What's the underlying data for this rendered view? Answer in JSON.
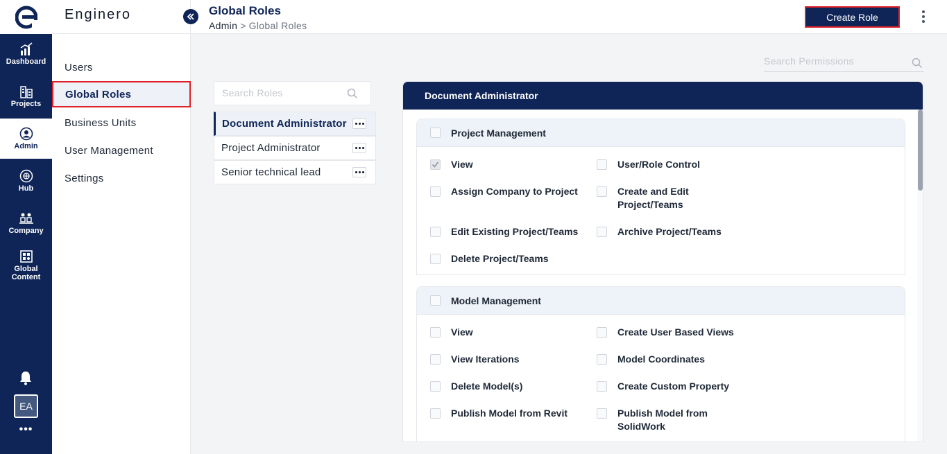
{
  "app": {
    "name": "Enginero",
    "logo_letter": "e"
  },
  "rail": {
    "items": [
      {
        "label": "Dashboard",
        "icon": "chart-up-icon"
      },
      {
        "label": "Projects",
        "icon": "buildings-icon"
      },
      {
        "label": "Admin",
        "icon": "admin-user-icon",
        "active": true
      },
      {
        "label": "Hub",
        "icon": "hub-network-icon"
      },
      {
        "label": "Company",
        "icon": "company-people-icon"
      },
      {
        "label": "Global",
        "label2": "Content",
        "icon": "global-content-icon"
      }
    ],
    "avatar_initials": "EA",
    "more": "•••"
  },
  "subnav": {
    "items": [
      {
        "label": "Users"
      },
      {
        "label": "Global Roles",
        "active": true
      },
      {
        "label": "Business Units"
      },
      {
        "label": "User Management"
      },
      {
        "label": "Settings"
      }
    ]
  },
  "header": {
    "title": "Global Roles",
    "breadcrumb_root": "Admin",
    "breadcrumb_sep": ">",
    "breadcrumb_current": "Global Roles",
    "create_role_label": "Create Role"
  },
  "search": {
    "permissions_placeholder": "Search Permissions",
    "roles_placeholder": "Search Roles"
  },
  "roles": [
    {
      "label": "Document Administrator",
      "active": true
    },
    {
      "label": "Project Administrator"
    },
    {
      "label": "Senior technical lead"
    }
  ],
  "panel": {
    "title": "Document Administrator",
    "groups": [
      {
        "title": "Project Management",
        "permissions": [
          {
            "label": "View",
            "checked": true
          },
          {
            "label": "User/Role Control",
            "checked": false
          },
          {
            "label": "Assign Company to Project",
            "checked": false
          },
          {
            "label": "Create and Edit",
            "label2": "Project/Teams",
            "checked": false
          },
          {
            "label": "Edit Existing Project/Teams",
            "checked": false
          },
          {
            "label": "Archive Project/Teams",
            "checked": false
          },
          {
            "label": "Delete Project/Teams",
            "checked": false
          }
        ]
      },
      {
        "title": "Model Management",
        "permissions": [
          {
            "label": "View",
            "checked": false
          },
          {
            "label": "Create User Based Views",
            "checked": false
          },
          {
            "label": "View Iterations",
            "checked": false
          },
          {
            "label": "Model Coordinates",
            "checked": false
          },
          {
            "label": "Delete Model(s)",
            "checked": false
          },
          {
            "label": "Create Custom Property",
            "checked": false
          },
          {
            "label": "Publish Model from Revit",
            "checked": false
          },
          {
            "label": "Publish Model from",
            "label2": "SolidWork",
            "checked": false
          }
        ]
      }
    ]
  },
  "colors": {
    "navy": "#0f2557",
    "highlight_red": "#e0212a",
    "group_header_bg": "#eef2f9"
  }
}
